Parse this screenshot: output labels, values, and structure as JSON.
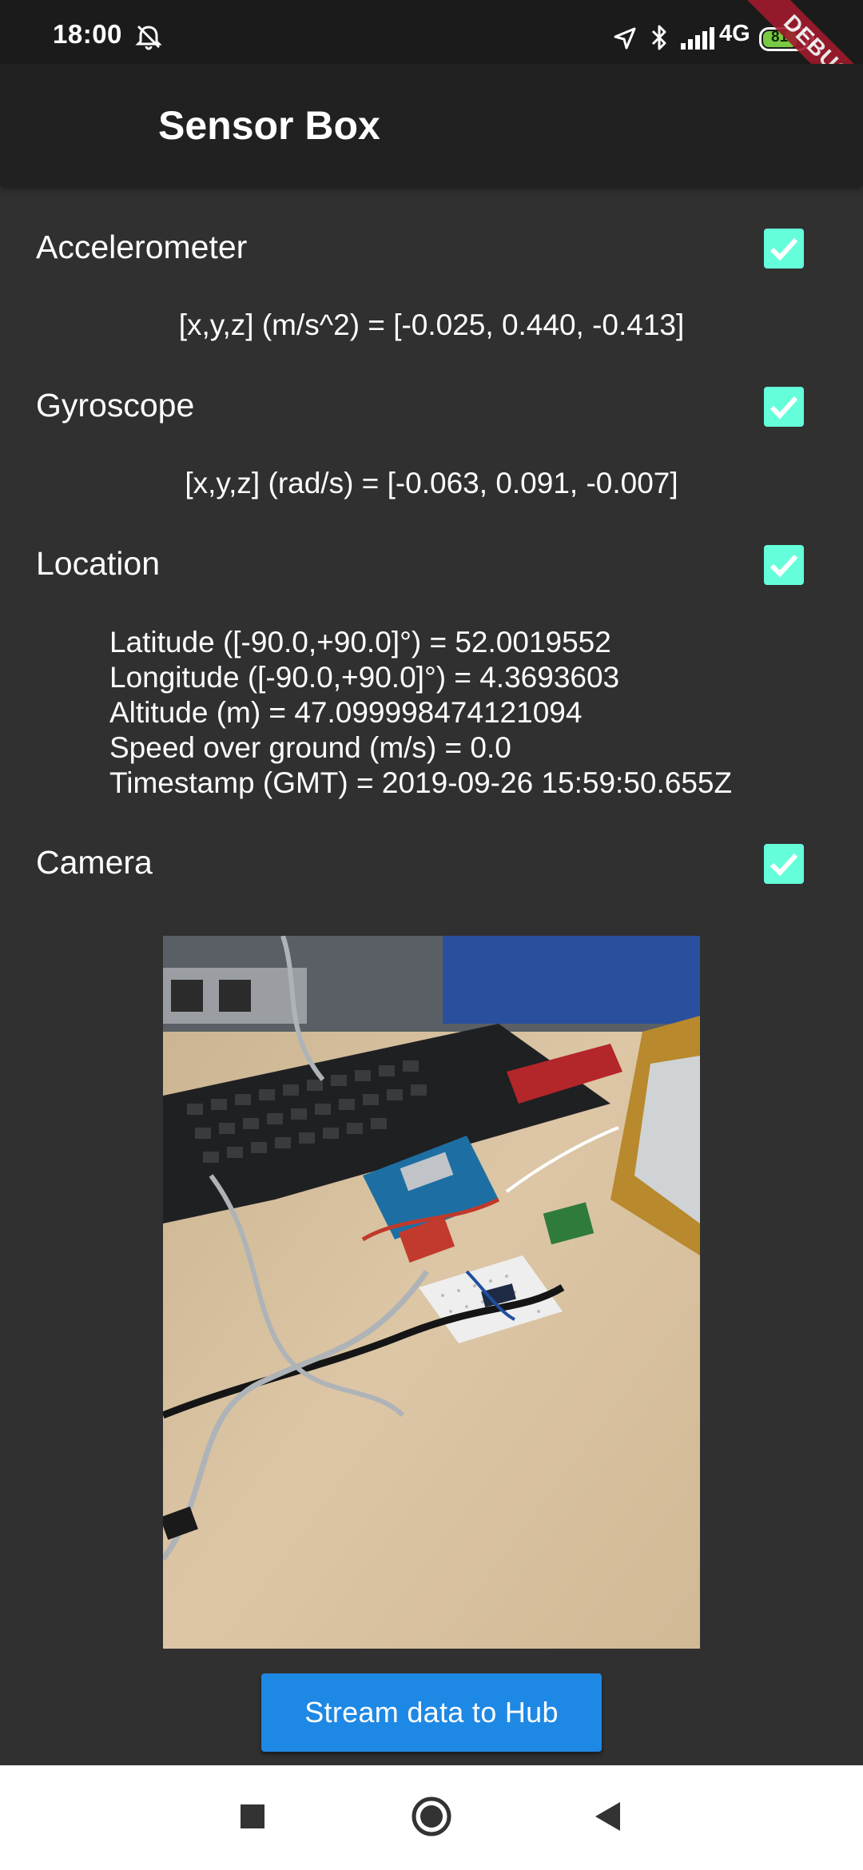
{
  "status_bar": {
    "time": "18:00",
    "network": "4G",
    "battery": "81",
    "battery_level": 0.81,
    "icons": [
      "alarm-off-icon",
      "location-icon",
      "bluetooth-icon",
      "signal-icon",
      "battery-icon"
    ]
  },
  "debug_banner": "DEBUG",
  "app_bar": {
    "title": "Sensor Box"
  },
  "sensors": {
    "accelerometer": {
      "label": "Accelerometer",
      "checked": true,
      "reading": "[x,y,z] (m/s^2) = [-0.025, 0.440, -0.413]"
    },
    "gyroscope": {
      "label": "Gyroscope",
      "checked": true,
      "reading": "[x,y,z] (rad/s) = [-0.063, 0.091, -0.007]"
    },
    "location": {
      "label": "Location",
      "checked": true,
      "lines": [
        "Latitude ([-90.0,+90.0]°) = 52.0019552",
        "Longitude ([-90.0,+90.0]°) = 4.3693603",
        "Altitude (m) = 47.099998474121094",
        "Speed over ground (m/s) = 0.0",
        "Timestamp (GMT) = 2019-09-26 15:59:50.655Z"
      ]
    },
    "camera": {
      "label": "Camera",
      "checked": true
    }
  },
  "stream_button": "Stream data to Hub",
  "nav_bar": {
    "buttons": [
      "recents-icon",
      "home-icon",
      "back-icon"
    ]
  },
  "colors": {
    "background": "#303030",
    "app_bar": "#212121",
    "checkbox": "#64ffda",
    "button": "#1e88e5",
    "ribbon": "#a01a2c"
  }
}
